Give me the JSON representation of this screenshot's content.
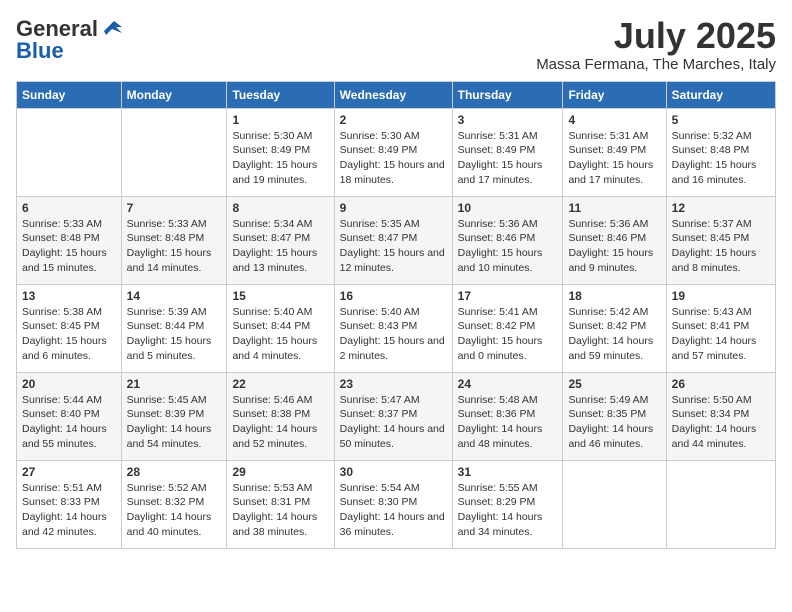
{
  "logo": {
    "general": "General",
    "blue": "Blue"
  },
  "title": "July 2025",
  "subtitle": "Massa Fermana, The Marches, Italy",
  "days_of_week": [
    "Sunday",
    "Monday",
    "Tuesday",
    "Wednesday",
    "Thursday",
    "Friday",
    "Saturday"
  ],
  "weeks": [
    [
      {
        "day": "",
        "sunrise": "",
        "sunset": "",
        "daylight": ""
      },
      {
        "day": "",
        "sunrise": "",
        "sunset": "",
        "daylight": ""
      },
      {
        "day": "1",
        "sunrise": "Sunrise: 5:30 AM",
        "sunset": "Sunset: 8:49 PM",
        "daylight": "Daylight: 15 hours and 19 minutes."
      },
      {
        "day": "2",
        "sunrise": "Sunrise: 5:30 AM",
        "sunset": "Sunset: 8:49 PM",
        "daylight": "Daylight: 15 hours and 18 minutes."
      },
      {
        "day": "3",
        "sunrise": "Sunrise: 5:31 AM",
        "sunset": "Sunset: 8:49 PM",
        "daylight": "Daylight: 15 hours and 17 minutes."
      },
      {
        "day": "4",
        "sunrise": "Sunrise: 5:31 AM",
        "sunset": "Sunset: 8:49 PM",
        "daylight": "Daylight: 15 hours and 17 minutes."
      },
      {
        "day": "5",
        "sunrise": "Sunrise: 5:32 AM",
        "sunset": "Sunset: 8:48 PM",
        "daylight": "Daylight: 15 hours and 16 minutes."
      }
    ],
    [
      {
        "day": "6",
        "sunrise": "Sunrise: 5:33 AM",
        "sunset": "Sunset: 8:48 PM",
        "daylight": "Daylight: 15 hours and 15 minutes."
      },
      {
        "day": "7",
        "sunrise": "Sunrise: 5:33 AM",
        "sunset": "Sunset: 8:48 PM",
        "daylight": "Daylight: 15 hours and 14 minutes."
      },
      {
        "day": "8",
        "sunrise": "Sunrise: 5:34 AM",
        "sunset": "Sunset: 8:47 PM",
        "daylight": "Daylight: 15 hours and 13 minutes."
      },
      {
        "day": "9",
        "sunrise": "Sunrise: 5:35 AM",
        "sunset": "Sunset: 8:47 PM",
        "daylight": "Daylight: 15 hours and 12 minutes."
      },
      {
        "day": "10",
        "sunrise": "Sunrise: 5:36 AM",
        "sunset": "Sunset: 8:46 PM",
        "daylight": "Daylight: 15 hours and 10 minutes."
      },
      {
        "day": "11",
        "sunrise": "Sunrise: 5:36 AM",
        "sunset": "Sunset: 8:46 PM",
        "daylight": "Daylight: 15 hours and 9 minutes."
      },
      {
        "day": "12",
        "sunrise": "Sunrise: 5:37 AM",
        "sunset": "Sunset: 8:45 PM",
        "daylight": "Daylight: 15 hours and 8 minutes."
      }
    ],
    [
      {
        "day": "13",
        "sunrise": "Sunrise: 5:38 AM",
        "sunset": "Sunset: 8:45 PM",
        "daylight": "Daylight: 15 hours and 6 minutes."
      },
      {
        "day": "14",
        "sunrise": "Sunrise: 5:39 AM",
        "sunset": "Sunset: 8:44 PM",
        "daylight": "Daylight: 15 hours and 5 minutes."
      },
      {
        "day": "15",
        "sunrise": "Sunrise: 5:40 AM",
        "sunset": "Sunset: 8:44 PM",
        "daylight": "Daylight: 15 hours and 4 minutes."
      },
      {
        "day": "16",
        "sunrise": "Sunrise: 5:40 AM",
        "sunset": "Sunset: 8:43 PM",
        "daylight": "Daylight: 15 hours and 2 minutes."
      },
      {
        "day": "17",
        "sunrise": "Sunrise: 5:41 AM",
        "sunset": "Sunset: 8:42 PM",
        "daylight": "Daylight: 15 hours and 0 minutes."
      },
      {
        "day": "18",
        "sunrise": "Sunrise: 5:42 AM",
        "sunset": "Sunset: 8:42 PM",
        "daylight": "Daylight: 14 hours and 59 minutes."
      },
      {
        "day": "19",
        "sunrise": "Sunrise: 5:43 AM",
        "sunset": "Sunset: 8:41 PM",
        "daylight": "Daylight: 14 hours and 57 minutes."
      }
    ],
    [
      {
        "day": "20",
        "sunrise": "Sunrise: 5:44 AM",
        "sunset": "Sunset: 8:40 PM",
        "daylight": "Daylight: 14 hours and 55 minutes."
      },
      {
        "day": "21",
        "sunrise": "Sunrise: 5:45 AM",
        "sunset": "Sunset: 8:39 PM",
        "daylight": "Daylight: 14 hours and 54 minutes."
      },
      {
        "day": "22",
        "sunrise": "Sunrise: 5:46 AM",
        "sunset": "Sunset: 8:38 PM",
        "daylight": "Daylight: 14 hours and 52 minutes."
      },
      {
        "day": "23",
        "sunrise": "Sunrise: 5:47 AM",
        "sunset": "Sunset: 8:37 PM",
        "daylight": "Daylight: 14 hours and 50 minutes."
      },
      {
        "day": "24",
        "sunrise": "Sunrise: 5:48 AM",
        "sunset": "Sunset: 8:36 PM",
        "daylight": "Daylight: 14 hours and 48 minutes."
      },
      {
        "day": "25",
        "sunrise": "Sunrise: 5:49 AM",
        "sunset": "Sunset: 8:35 PM",
        "daylight": "Daylight: 14 hours and 46 minutes."
      },
      {
        "day": "26",
        "sunrise": "Sunrise: 5:50 AM",
        "sunset": "Sunset: 8:34 PM",
        "daylight": "Daylight: 14 hours and 44 minutes."
      }
    ],
    [
      {
        "day": "27",
        "sunrise": "Sunrise: 5:51 AM",
        "sunset": "Sunset: 8:33 PM",
        "daylight": "Daylight: 14 hours and 42 minutes."
      },
      {
        "day": "28",
        "sunrise": "Sunrise: 5:52 AM",
        "sunset": "Sunset: 8:32 PM",
        "daylight": "Daylight: 14 hours and 40 minutes."
      },
      {
        "day": "29",
        "sunrise": "Sunrise: 5:53 AM",
        "sunset": "Sunset: 8:31 PM",
        "daylight": "Daylight: 14 hours and 38 minutes."
      },
      {
        "day": "30",
        "sunrise": "Sunrise: 5:54 AM",
        "sunset": "Sunset: 8:30 PM",
        "daylight": "Daylight: 14 hours and 36 minutes."
      },
      {
        "day": "31",
        "sunrise": "Sunrise: 5:55 AM",
        "sunset": "Sunset: 8:29 PM",
        "daylight": "Daylight: 14 hours and 34 minutes."
      },
      {
        "day": "",
        "sunrise": "",
        "sunset": "",
        "daylight": ""
      },
      {
        "day": "",
        "sunrise": "",
        "sunset": "",
        "daylight": ""
      }
    ]
  ]
}
